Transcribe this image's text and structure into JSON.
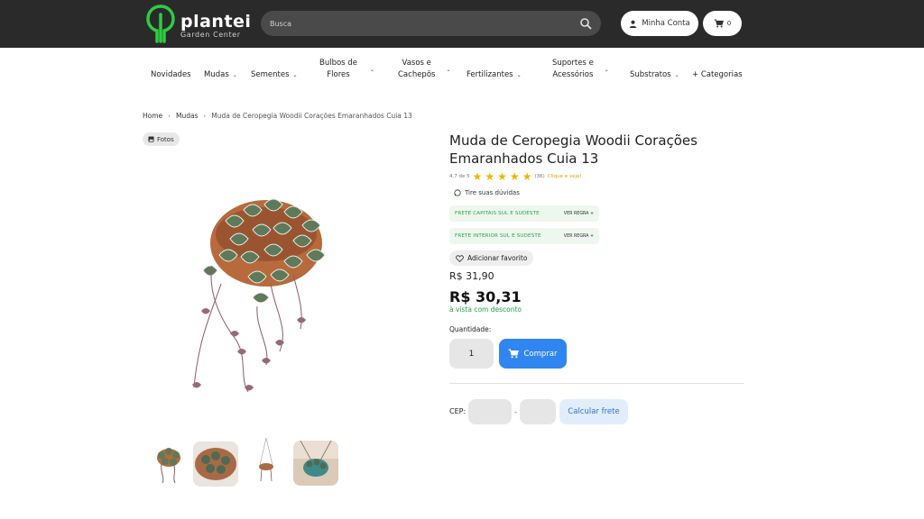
{
  "header": {
    "logo_name": "plantei",
    "logo_sub": "Garden Center",
    "search_placeholder": "Busca",
    "account_label": "Minha Conta",
    "cart_count": "0"
  },
  "nav": {
    "items": [
      {
        "label": "Novidades"
      },
      {
        "label": "Mudas"
      },
      {
        "label": "Sementes"
      },
      {
        "label": "Bulbos de\nFlores"
      },
      {
        "label": "Vasos e\nCachepôs"
      },
      {
        "label": "Fertilizantes"
      },
      {
        "label": "Suportes e\nAcessórios"
      },
      {
        "label": "Substratos"
      },
      {
        "label": "+ Categorias"
      }
    ]
  },
  "breadcrumb": {
    "home": "Home",
    "category": "Mudas",
    "current": "Muda de Ceropegia Woodii Corações Emaranhados Cuia 13"
  },
  "gallery": {
    "fotos_label": "Fotos"
  },
  "product": {
    "title": "Muda de Ceropegia Woodii Corações Emaranhados Cuia 13",
    "rating_text": "4.7 de 5",
    "rating_value": 4.7,
    "rating_count": "(36)",
    "rating_link": "Clique e veja!",
    "question": "Tire suas dúvidas",
    "frete1": "FRETE CAPITAIS SUL E SUDESTE",
    "frete2": "FRETE INTERIOR SUL E SUDESTE",
    "rule_label": "VER REGRA  +",
    "favorite": "Adicionar favorito",
    "old_price": "R$ 31,90",
    "price": "R$ 30,31",
    "price_note": "à vista com desconto",
    "qty_label": "Quantidade:",
    "qty_value": "1",
    "buy_label": "Comprar",
    "cep_label": "CEP:",
    "cep_dash": "-",
    "calc_label": "Calcular frete"
  },
  "colors": {
    "topbar": "#2a2a2a",
    "brand_green": "#2ecc40",
    "buy_blue": "#2f86f0",
    "promo_green": "#21a34a",
    "star": "#f5b301"
  }
}
